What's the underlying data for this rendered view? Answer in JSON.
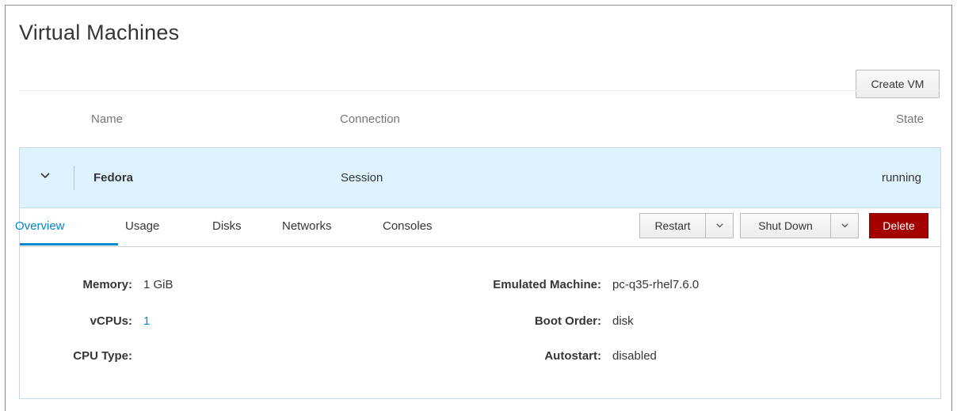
{
  "header": {
    "title": "Virtual Machines",
    "create_button": "Create VM"
  },
  "table": {
    "columns": [
      "Name",
      "Connection",
      "State"
    ]
  },
  "vm": {
    "name": "Fedora",
    "connection": "Session",
    "state": "running",
    "expand_icon": "chevron-down-icon"
  },
  "tabs": [
    {
      "label": "Overview",
      "active": true
    },
    {
      "label": "Usage",
      "active": false
    },
    {
      "label": "Disks",
      "active": false
    },
    {
      "label": "Networks",
      "active": false
    },
    {
      "label": "Consoles",
      "active": false
    }
  ],
  "actions": {
    "restart": "Restart",
    "restart_menu_icon": "chevron-down-icon",
    "shutdown": "Shut Down",
    "shutdown_menu_icon": "chevron-down-icon",
    "delete": "Delete"
  },
  "overview": {
    "left": [
      {
        "label": "Memory:",
        "value": "1 GiB"
      },
      {
        "label": "vCPUs:",
        "value": "1"
      },
      {
        "label": "CPU Type:",
        "value": ""
      }
    ],
    "right": [
      {
        "label": "Emulated Machine:",
        "value": "pc-q35-rhel7.6.0"
      },
      {
        "label": "Boot Order:",
        "value": "disk"
      },
      {
        "label": "Autostart:",
        "value": "disabled"
      }
    ]
  },
  "colors": {
    "accent": "#0088ce",
    "row_highlight": "#def3ff",
    "danger": "#a30000"
  }
}
